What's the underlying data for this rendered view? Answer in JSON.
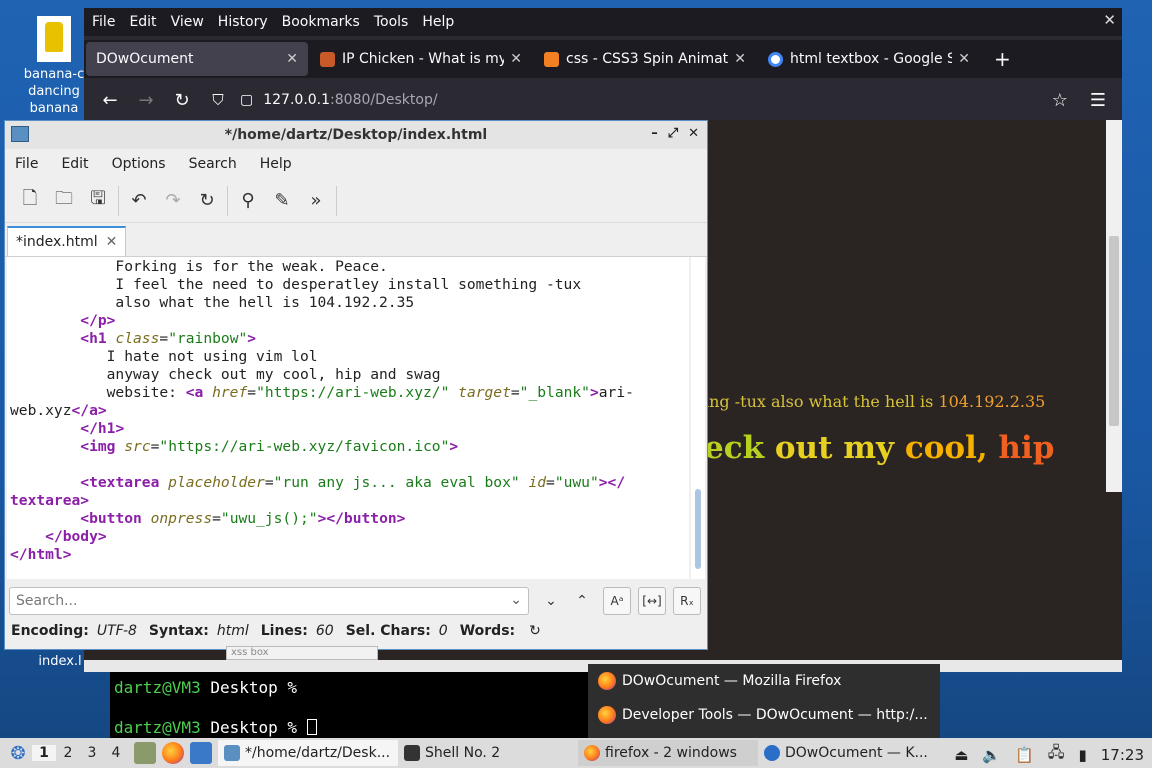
{
  "desktop": {
    "icon1_label": "banana-c dancing banana",
    "icon2_label": "index.l"
  },
  "firefox": {
    "menu": [
      "File",
      "Edit",
      "View",
      "History",
      "Bookmarks",
      "Tools",
      "Help"
    ],
    "tabs": [
      {
        "title": "DOwOcument",
        "icon": "blank-page-icon",
        "color": "#42414d"
      },
      {
        "title": "IP Chicken - What is my IP",
        "icon": "chicken-icon",
        "color": "#c85a2a"
      },
      {
        "title": "css - CSS3 Spin Animation",
        "icon": "stackoverflow-icon",
        "color": "#f48024"
      },
      {
        "title": "html textbox - Google Search",
        "icon": "google-icon",
        "color": "#4285f4"
      }
    ],
    "url_host": "127.0.0.1",
    "url_path": ":8080/Desktop/",
    "page": {
      "line1_text": "ing -tux also what the hell is ",
      "line1_num": "104.192.2.35",
      "h1_parts": [
        "eck ",
        "out my ",
        "cool, ",
        "hip"
      ]
    }
  },
  "editor": {
    "title": "*/home/dartz/Desktop/index.html",
    "menu": [
      "File",
      "Edit",
      "Options",
      "Search",
      "Help"
    ],
    "tab_label": "*index.html",
    "code": {
      "l1": "            Forking is for the weak. Peace.",
      "l2": "            I feel the need to desperatley install something -tux",
      "l3": "            also what the hell is 104.192.2.35",
      "l4_tag": "</p>",
      "l5_open": "<h1",
      "l5_attr": "class",
      "l5_val": "\"rainbow\"",
      "l5_close": ">",
      "l6": "           I hate not using vim lol",
      "l7": "           anyway check out my cool, hip and swag",
      "l8_text": "           website: ",
      "l8_tag": "<a",
      "l8_attr1": "href",
      "l8_val1": "\"https://ari-web.xyz/\"",
      "l8_attr2": "target",
      "l8_val2": "\"_blank\"",
      "l8_after": "ari-",
      "l9_text": "web.xyz",
      "l9_tag": "</a>",
      "l10_tag": "</h1>",
      "l11_tag": "<img",
      "l11_attr": "src",
      "l11_val": "\"https://ari-web.xyz/favicon.ico\"",
      "l11_close": ">",
      "l13_tag": "<textarea",
      "l13_attr1": "placeholder",
      "l13_val1": "\"run any js... aka eval box\"",
      "l13_attr2": "id",
      "l13_val2": "\"uwu\"",
      "l13_close": "></",
      "l14_tag": "textarea>",
      "l15_tag": "<button",
      "l15_attr": "onpress",
      "l15_val": "\"uwu_js();\"",
      "l15_close": "></button>",
      "l16_tag": "</body>",
      "l17_tag": "</html>"
    },
    "search_placeholder": "Search...",
    "status": {
      "encoding_label": "Encoding:",
      "encoding": "UTF-8",
      "syntax_label": "Syntax:",
      "syntax": "html",
      "lines_label": "Lines:",
      "lines": "60",
      "sel_label": "Sel. Chars:",
      "sel": "0",
      "words_label": "Words:"
    }
  },
  "terminal": {
    "user": "dartz@VM3",
    "path_prompt": " Desktop %",
    "behind_label": "xss box"
  },
  "popup": {
    "items": [
      "DOwOcument — Mozilla Firefox",
      "Developer Tools — DOwOcument — http:/..."
    ]
  },
  "taskbar": {
    "workspaces": [
      "1",
      "2",
      "3",
      "4"
    ],
    "tasks": [
      {
        "label": "*/home/dartz/Desk...",
        "icon": "text-editor-icon",
        "color": "#5a8fc2"
      },
      {
        "label": "Shell No. 2",
        "icon": "terminal-icon",
        "color": "#333333"
      },
      {
        "label": "firefox - 2 windows",
        "icon": "firefox-icon",
        "color": "#ff7a1a"
      },
      {
        "label": "DOwOcument — K...",
        "icon": "browser-icon",
        "color": "#2a6ec8"
      }
    ],
    "clock": "17:23"
  }
}
